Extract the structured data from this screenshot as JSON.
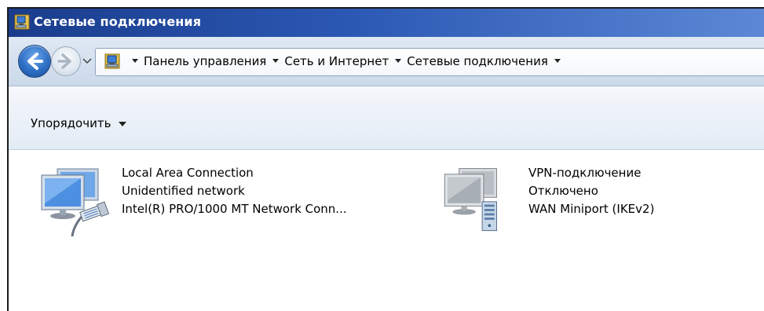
{
  "window": {
    "title": "Сетевые подключения"
  },
  "address_bar": {
    "breadcrumbs": [
      "Панель управления",
      "Сеть и Интернет",
      "Сетевые подключения"
    ]
  },
  "toolbar": {
    "organize_label": "Упорядочить"
  },
  "connections": [
    {
      "name": "Local Area Connection",
      "status": "Unidentified network",
      "device": "Intel(R) PRO/1000 MT Network Conn...",
      "icon": "network-adapter-ethernet-icon"
    },
    {
      "name": "VPN-подключение",
      "status": "Отключено",
      "device": "WAN Miniport (IKEv2)",
      "icon": "vpn-connection-icon"
    }
  ],
  "colors": {
    "titlebar": "#2b58b3",
    "address_row": "#d4e0ee",
    "toolbar": "#e8eff7"
  }
}
